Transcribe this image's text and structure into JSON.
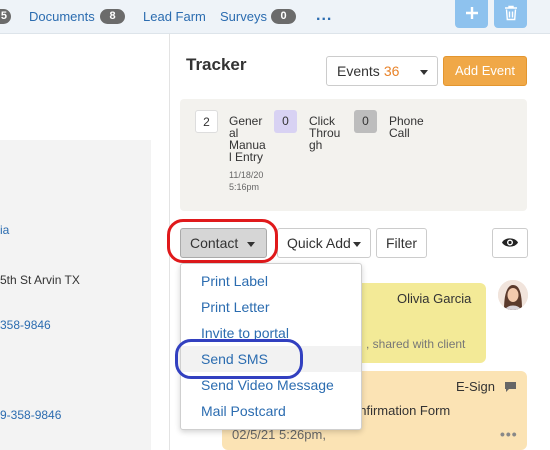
{
  "nav": {
    "cut_badge": "5",
    "documents_label": "Documents",
    "documents_count": "8",
    "lead_farm_label": "Lead Farm",
    "surveys_label": "Surveys",
    "surveys_count": "0",
    "more_label": "..."
  },
  "left_panel": {
    "name_fragment": "ia",
    "address_fragment": "5th St Arvin TX",
    "phone_fragment_1": "358-9846",
    "phone_fragment_2": "9-358-9846"
  },
  "tracker": {
    "title": "Tracker",
    "events_label": "Events",
    "events_count": "36",
    "add_event_label": "Add Event"
  },
  "summary": {
    "manual_count": "2",
    "manual_label_lines": [
      "Gener",
      "al",
      "Manua",
      "l Entry"
    ],
    "manual_date_lines": [
      "11/18/20",
      "5:16pm"
    ],
    "click_count": "0",
    "click_label_lines": [
      "Click",
      "Throu",
      "gh"
    ],
    "phone_count": "0",
    "phone_label_lines": [
      "Phone",
      "Call"
    ]
  },
  "toolbar": {
    "contact_label": "Contact",
    "quick_add_label": "Quick Add",
    "filter_label": "Filter"
  },
  "contact_menu": {
    "items": [
      "Print Label",
      "Print Letter",
      "Invite to portal",
      "Send SMS",
      "Send Video Message",
      "Mail Postcard"
    ]
  },
  "timeline": {
    "note_author": "Olivia Garcia",
    "note_shared": ", shared with client",
    "esign_label": "E-Sign",
    "esign_title_fragment": "onfirmation Form",
    "esign_time_fragment": "02/5/21 5:26pm,"
  },
  "colors": {
    "accent_orange": "#f0a847",
    "link_blue": "#2b6cb0",
    "annotation_red": "#e0191b",
    "annotation_blue": "#3240c0"
  }
}
